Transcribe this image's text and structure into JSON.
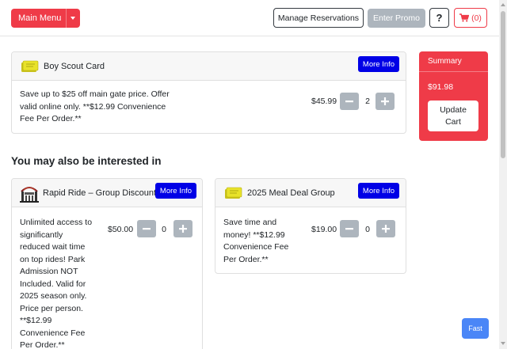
{
  "header": {
    "main_menu_label": "Main Menu",
    "manage_reservations_label": "Manage Reservations",
    "enter_promo_label": "Enter Promo",
    "help_label": "?",
    "cart_count": "(0)"
  },
  "cart_item": {
    "title": "Boy Scout Card",
    "more_info_label": "More Info",
    "description": "Save up to $25 off main gate price. Offer valid online only. **$12.99 Convenience Fee Per Order.**",
    "price": "$45.99",
    "quantity": "2",
    "icon": "ticket-icon"
  },
  "summary": {
    "heading": "Summary",
    "total": "$91.98",
    "update_label": "Update Cart"
  },
  "suggestions": {
    "heading": "You may also be interested in",
    "items": [
      {
        "title": "Rapid Ride – Group Discount",
        "more_info_label": "More Info",
        "description": "Unlimited access to significantly reduced wait time on top rides! Park Admission NOT Included. Valid for 2025 season only. Price per person. **$12.99 Convenience Fee Per Order.**",
        "price": "$50.00",
        "quantity": "0",
        "icon": "park-gate-icon"
      },
      {
        "title": "2025 Meal Deal Group",
        "more_info_label": "More Info",
        "description": "Save time and money! **$12.99 Convenience Fee Per Order.**",
        "price": "$19.00",
        "quantity": "0",
        "icon": "ticket-icon"
      }
    ]
  },
  "fast_button_label": "Fast",
  "colors": {
    "brand_red": "#ef3b48",
    "more_info_blue": "#0000e6",
    "stepper_gray": "#adb5bd",
    "fast_blue": "#4a86f7",
    "ticket_yellow": "#e8e22a"
  }
}
